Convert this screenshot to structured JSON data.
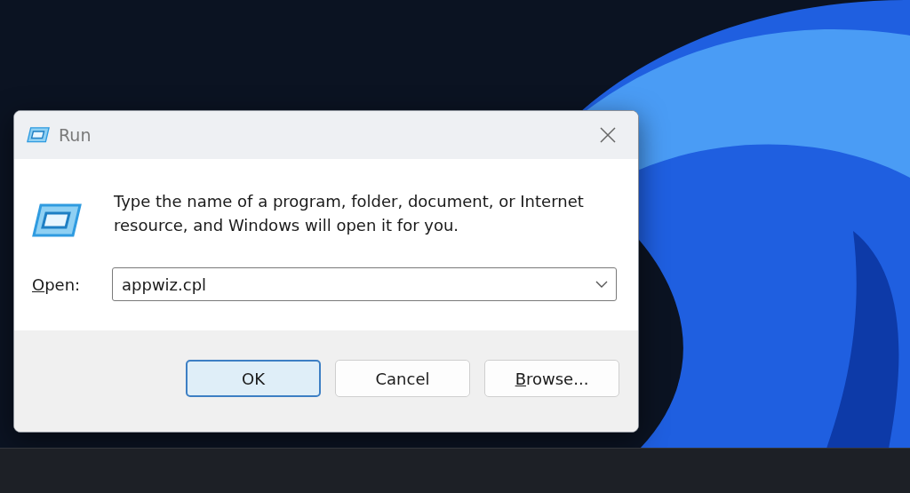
{
  "window": {
    "title": "Run"
  },
  "message": "Type the name of a program, folder, document, or Internet resource, and Windows will open it for you.",
  "open_field": {
    "label_key": "O",
    "label_rest": "pen:",
    "value": "appwiz.cpl"
  },
  "buttons": [
    {
      "label": "OK",
      "default": true
    },
    {
      "label": "Cancel",
      "default": false
    },
    {
      "key": "B",
      "label": "rowse...",
      "default": false
    }
  ]
}
